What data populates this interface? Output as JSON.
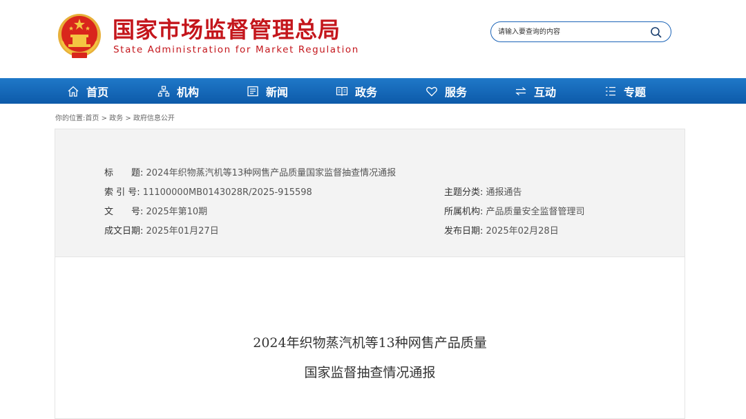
{
  "site": {
    "name_cn": "国家市场监督管理总局",
    "name_en": "State Administration for Market Regulation"
  },
  "search": {
    "placeholder": "请输入要查询的内容"
  },
  "nav": {
    "items": [
      {
        "label": "首页",
        "icon": "home-icon"
      },
      {
        "label": "机构",
        "icon": "org-chart-icon"
      },
      {
        "label": "新闻",
        "icon": "news-icon"
      },
      {
        "label": "政务",
        "icon": "book-icon"
      },
      {
        "label": "服务",
        "icon": "heart-icon"
      },
      {
        "label": "互动",
        "icon": "exchange-icon"
      },
      {
        "label": "专题",
        "icon": "list-icon"
      }
    ]
  },
  "breadcrumb": {
    "prefix": "你的位置:",
    "items": [
      "首页",
      "政务",
      "政府信息公开"
    ],
    "separator": ">"
  },
  "meta": {
    "title_label": "标　　题:",
    "title_value": "2024年织物蒸汽机等13种网售产品质量国家监督抽查情况通报",
    "index_label": "索 引 号:",
    "index_value": "11100000MB0143028R/2025-915598",
    "category_label": "主题分类:",
    "category_value": "通报通告",
    "docno_label": "文　　号:",
    "docno_value": "2025年第10期",
    "org_label": "所属机构:",
    "org_value": "产品质量安全监督管理司",
    "written_label": "成文日期:",
    "written_value": "2025年01月27日",
    "published_label": "发布日期:",
    "published_value": "2025年02月28日"
  },
  "document": {
    "title_line1": "2024年织物蒸汽机等13种网售产品质量",
    "title_line2": "国家监督抽查情况通报"
  },
  "colors": {
    "brand_red": "#c4161c",
    "nav_blue": "#1569b8"
  }
}
